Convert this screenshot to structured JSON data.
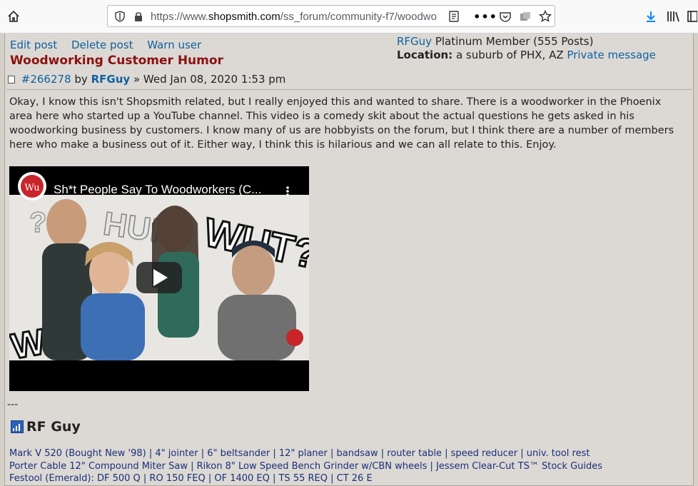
{
  "browser": {
    "url_prefix": "https://www.",
    "url_host": "shopsmith.com",
    "url_path": "/ss_forum/community-f7/woodwo"
  },
  "post": {
    "edit_label": "Edit post",
    "delete_label": "Delete post",
    "warn_label": "Warn user",
    "title": "Woodworking Customer Humor",
    "post_id": "#266278",
    "by": "by",
    "author": "RFGuy",
    "date": "» Wed Jan 08, 2020 1:53 pm",
    "body": "Okay, I know this isn't Shopsmith related, but I really enjoyed this and wanted to share. There is a woodworker in the Phoenix area here who started up a YouTube channel. This video is a comedy skit about the actual questions he gets asked in his woodworking business by customers. I know many of us are hobbyists on the forum, but I think there are a number of members here who make a business out of it. Either way, I think this is hilarious and we can all relate to this. Enjoy."
  },
  "profile": {
    "username": "RFGuy",
    "rank": "Platinum Member (555 Posts)",
    "location_label": "Location:",
    "location_value": "a suburb of PHX, AZ",
    "pm_label": "Private message"
  },
  "video": {
    "title": "Sh*t People Say To Woodworkers (C...",
    "channel_logo": "Wu",
    "overlay_words": [
      "HUH",
      "WUT?",
      "WADU?",
      "??"
    ]
  },
  "signature": {
    "dash": "---",
    "name": "RF Guy",
    "lines": [
      "Mark V 520 (Bought New '98) | 4\" jointer | 6\" beltsander | 12\" planer | bandsaw | router table | speed reducer | univ. tool rest",
      "Porter Cable 12\" Compound Miter Saw | Rikon 8\" Low Speed Bench Grinder w/CBN wheels | Jessem Clear-Cut TS™ Stock Guides",
      "Festool (Emerald): DF 500 Q | RO 150 FEQ | OF 1400 EQ | TS 55 REQ | CT 26 E"
    ]
  },
  "colors": {
    "link": "#1060a0",
    "title": "#8b1010",
    "background": "#dcd9d4",
    "signature": "#1a2f7a"
  }
}
